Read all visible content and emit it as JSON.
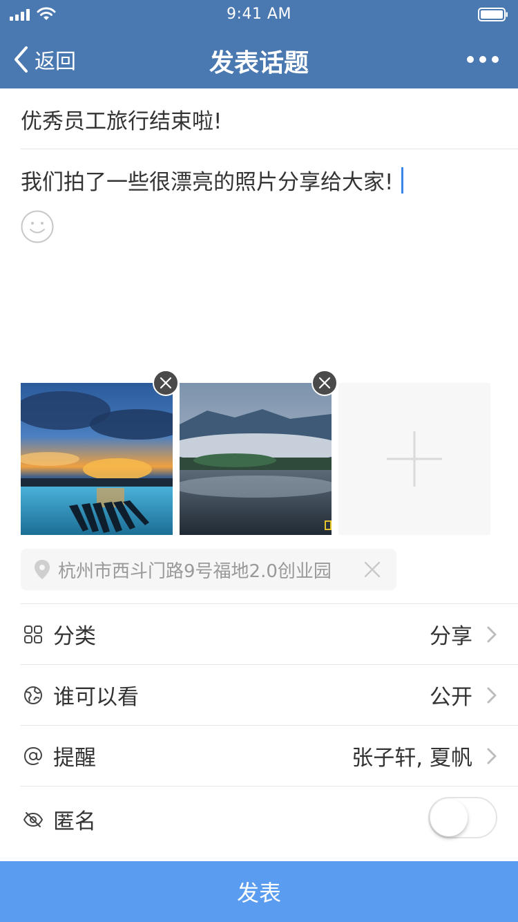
{
  "status_bar": {
    "time": "9:41 AM"
  },
  "nav": {
    "back_label": "返回",
    "title": "发表话题"
  },
  "post": {
    "title": "优秀员工旅行结束啦!",
    "body": "我们拍了一些很漂亮的照片分享给大家!"
  },
  "location": {
    "text": "杭州市西斗门路9号福地2.0创业园"
  },
  "settings": {
    "category": {
      "label": "分类",
      "value": "分享"
    },
    "visibility": {
      "label": "谁可以看",
      "value": "公开"
    },
    "mention": {
      "label": "提醒",
      "value": "张子轩, 夏帆"
    },
    "anonymous": {
      "label": "匿名",
      "enabled": false
    }
  },
  "submit_label": "发表",
  "colors": {
    "nav_bg": "#4a78b0",
    "submit_bg": "#5a9df0",
    "cursor": "#3a86e8"
  }
}
